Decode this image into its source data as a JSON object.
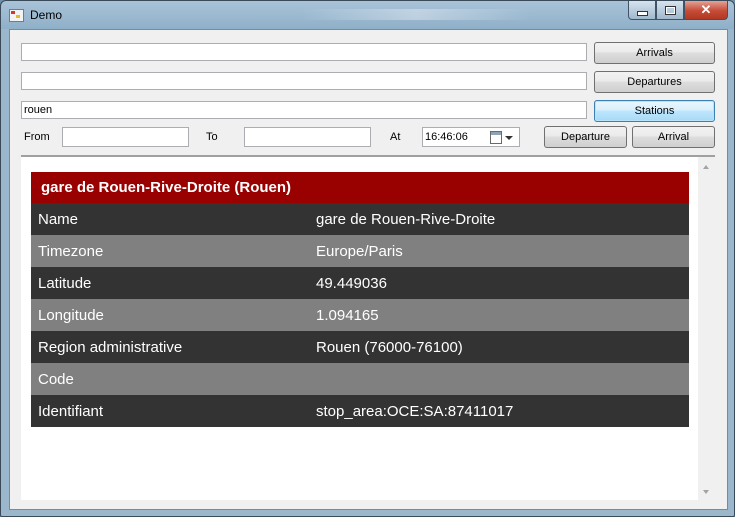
{
  "window": {
    "title": "Demo"
  },
  "search": {
    "arrivals_input": "",
    "departures_input": "",
    "stations_input": "rouen",
    "arrivals_button": "Arrivals",
    "departures_button": "Departures",
    "stations_button": "Stations"
  },
  "query": {
    "from_label": "From",
    "from_value": "",
    "to_label": "To",
    "to_value": "",
    "at_label": "At",
    "time_value": "16:46:06",
    "departure_button": "Departure",
    "arrival_button": "Arrival"
  },
  "station": {
    "header": "gare de Rouen-Rive-Droite (Rouen)",
    "rows": [
      {
        "label": "Name",
        "value": "gare de Rouen-Rive-Droite"
      },
      {
        "label": "Timezone",
        "value": "Europe/Paris"
      },
      {
        "label": "Latitude",
        "value": "49.449036"
      },
      {
        "label": "Longitude",
        "value": "1.094165"
      },
      {
        "label": "Region administrative",
        "value": "Rouen (76000-76100)"
      },
      {
        "label": "Code",
        "value": ""
      },
      {
        "label": "Identifiant",
        "value": "stop_area:OCE:SA:87411017"
      }
    ]
  },
  "colors": {
    "header_bg": "#990000",
    "row_dark": "#333333",
    "row_light": "#808080"
  },
  "icons": [
    "app-icon",
    "minimize-icon",
    "maximize-icon",
    "close-icon",
    "calendar-icon",
    "chevron-down-icon",
    "scroll-up-icon",
    "scroll-down-icon"
  ]
}
